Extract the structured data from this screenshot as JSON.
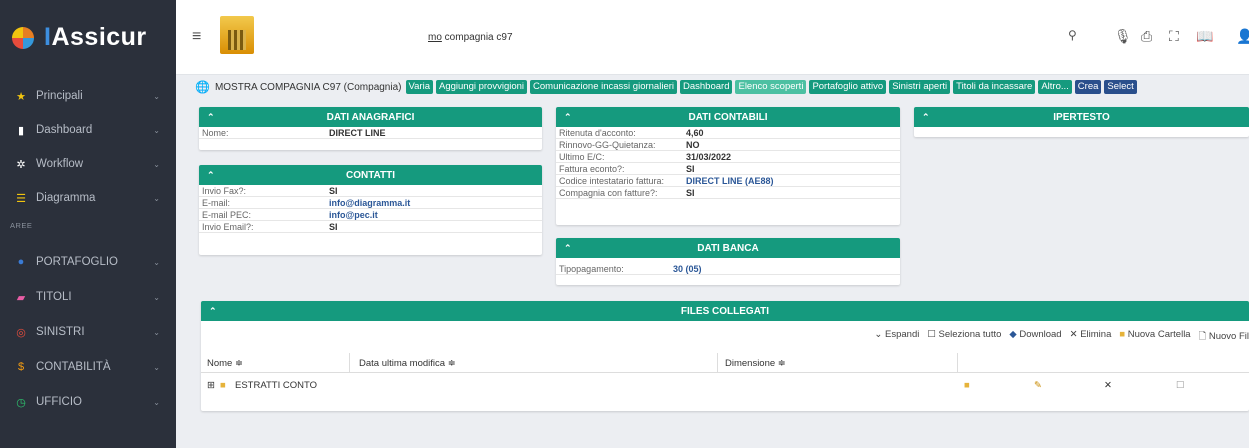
{
  "app": {
    "name_prefix": "I",
    "name_rest": "Assicur"
  },
  "sidebar": {
    "items": [
      {
        "label": "Principali",
        "icon": "star-icon",
        "glyph": "★",
        "color": "#b7bdc7",
        "icon_color": "#f1c40f"
      },
      {
        "label": "Dashboard",
        "icon": "bar-chart-icon",
        "glyph": "▮",
        "color": "#b7bdc7",
        "icon_color": "#ffffff"
      },
      {
        "label": "Workflow",
        "icon": "workflow-icon",
        "glyph": "✲",
        "color": "#b7bdc7",
        "icon_color": "#ffffff"
      },
      {
        "label": "Diagramma",
        "icon": "list-icon",
        "glyph": "☰",
        "color": "#b7bdc7",
        "icon_color": "#f1c40f"
      }
    ],
    "section_label": "AREE",
    "areas": [
      {
        "label": "PORTAFOGLIO",
        "icon": "globe-icon",
        "glyph": "●",
        "color": "#b7bdc7",
        "icon_color": "#3a7bd5"
      },
      {
        "label": "TITOLI",
        "icon": "tickets-icon",
        "glyph": "▰",
        "color": "#b7bdc7",
        "icon_color": "#e85da5"
      },
      {
        "label": "SINISTRI",
        "icon": "lifebuoy-icon",
        "glyph": "◎",
        "color": "#b7bdc7",
        "icon_color": "#e74c3c"
      },
      {
        "label": "CONTABILITÀ",
        "icon": "dollar-icon",
        "glyph": "$",
        "color": "#b7bdc7",
        "icon_color": "#f39c12"
      },
      {
        "label": "UFFICIO",
        "icon": "clock-icon",
        "glyph": "◷",
        "color": "#b7bdc7",
        "icon_color": "#2ecc71"
      }
    ]
  },
  "topbar": {
    "search_value_underlined": "mo",
    "search_value_rest": " compagnia c97"
  },
  "page": {
    "title": "MOSTRA COMPAGNIA C97 (Compagnia)",
    "actions": [
      {
        "label": "Varia",
        "style": "green"
      },
      {
        "label": "Aggiungi provvigioni",
        "style": "green"
      },
      {
        "label": "Comunicazione incassi giornalieri",
        "style": "green"
      },
      {
        "label": "Dashboard",
        "style": "green"
      },
      {
        "label": "Elenco scoperti",
        "style": "light"
      },
      {
        "label": "Portafoglio attivo",
        "style": "green"
      },
      {
        "label": "Sinistri aperti",
        "style": "green"
      },
      {
        "label": "Titoli da incassare",
        "style": "green"
      },
      {
        "label": "Altro...",
        "style": "green"
      },
      {
        "label": "Crea",
        "style": "blue"
      },
      {
        "label": "Select",
        "style": "blue"
      }
    ]
  },
  "anagrafici": {
    "title": "DATI ANAGRAFICI",
    "rows": [
      {
        "k": "Nome:",
        "v": "DIRECT LINE"
      }
    ]
  },
  "contatti": {
    "title": "CONTATTI",
    "rows": [
      {
        "k": "Invio Fax?:",
        "v": "SI",
        "link": false
      },
      {
        "k": "E-mail:",
        "v": "info@diagramma.it",
        "link": true
      },
      {
        "k": "E-mail PEC:",
        "v": "info@pec.it",
        "link": true
      },
      {
        "k": "Invio Email?:",
        "v": "SI",
        "link": false
      }
    ]
  },
  "contabili": {
    "title": "DATI CONTABILI",
    "rows": [
      {
        "k": "Ritenuta d'acconto:",
        "v": "4,60",
        "link": false
      },
      {
        "k": "Rinnovo-GG-Quietanza:",
        "v": "NO",
        "link": false
      },
      {
        "k": "Ultimo E/C:",
        "v": "31/03/2022",
        "link": false
      },
      {
        "k": "Fattura econto?:",
        "v": "SI",
        "link": false
      },
      {
        "k": "Codice intestatario fattura:",
        "v": "DIRECT LINE (AE88)",
        "link": true
      },
      {
        "k": "Compagnia con fatture?:",
        "v": "SI",
        "link": false
      }
    ]
  },
  "banca": {
    "title": "DATI BANCA",
    "rows": [
      {
        "k": "Tipopagamento:",
        "v": "30 (05)",
        "link": true
      }
    ]
  },
  "ipertesto": {
    "title": "IPERTESTO"
  },
  "files": {
    "title": "FILES COLLEGATI",
    "toolbar": {
      "expand": "Espandi",
      "select_all": "Seleziona tutto",
      "download": "Download",
      "delete": "Elimina",
      "new_folder": "Nuova Cartella",
      "new_file": "Nuovo Fil"
    },
    "columns": {
      "name": "Nome ≑",
      "modified": "Data ultima modifica ≑",
      "size": "Dimensione ≑"
    },
    "rows": [
      {
        "name": "ESTRATTI CONTO"
      }
    ]
  }
}
